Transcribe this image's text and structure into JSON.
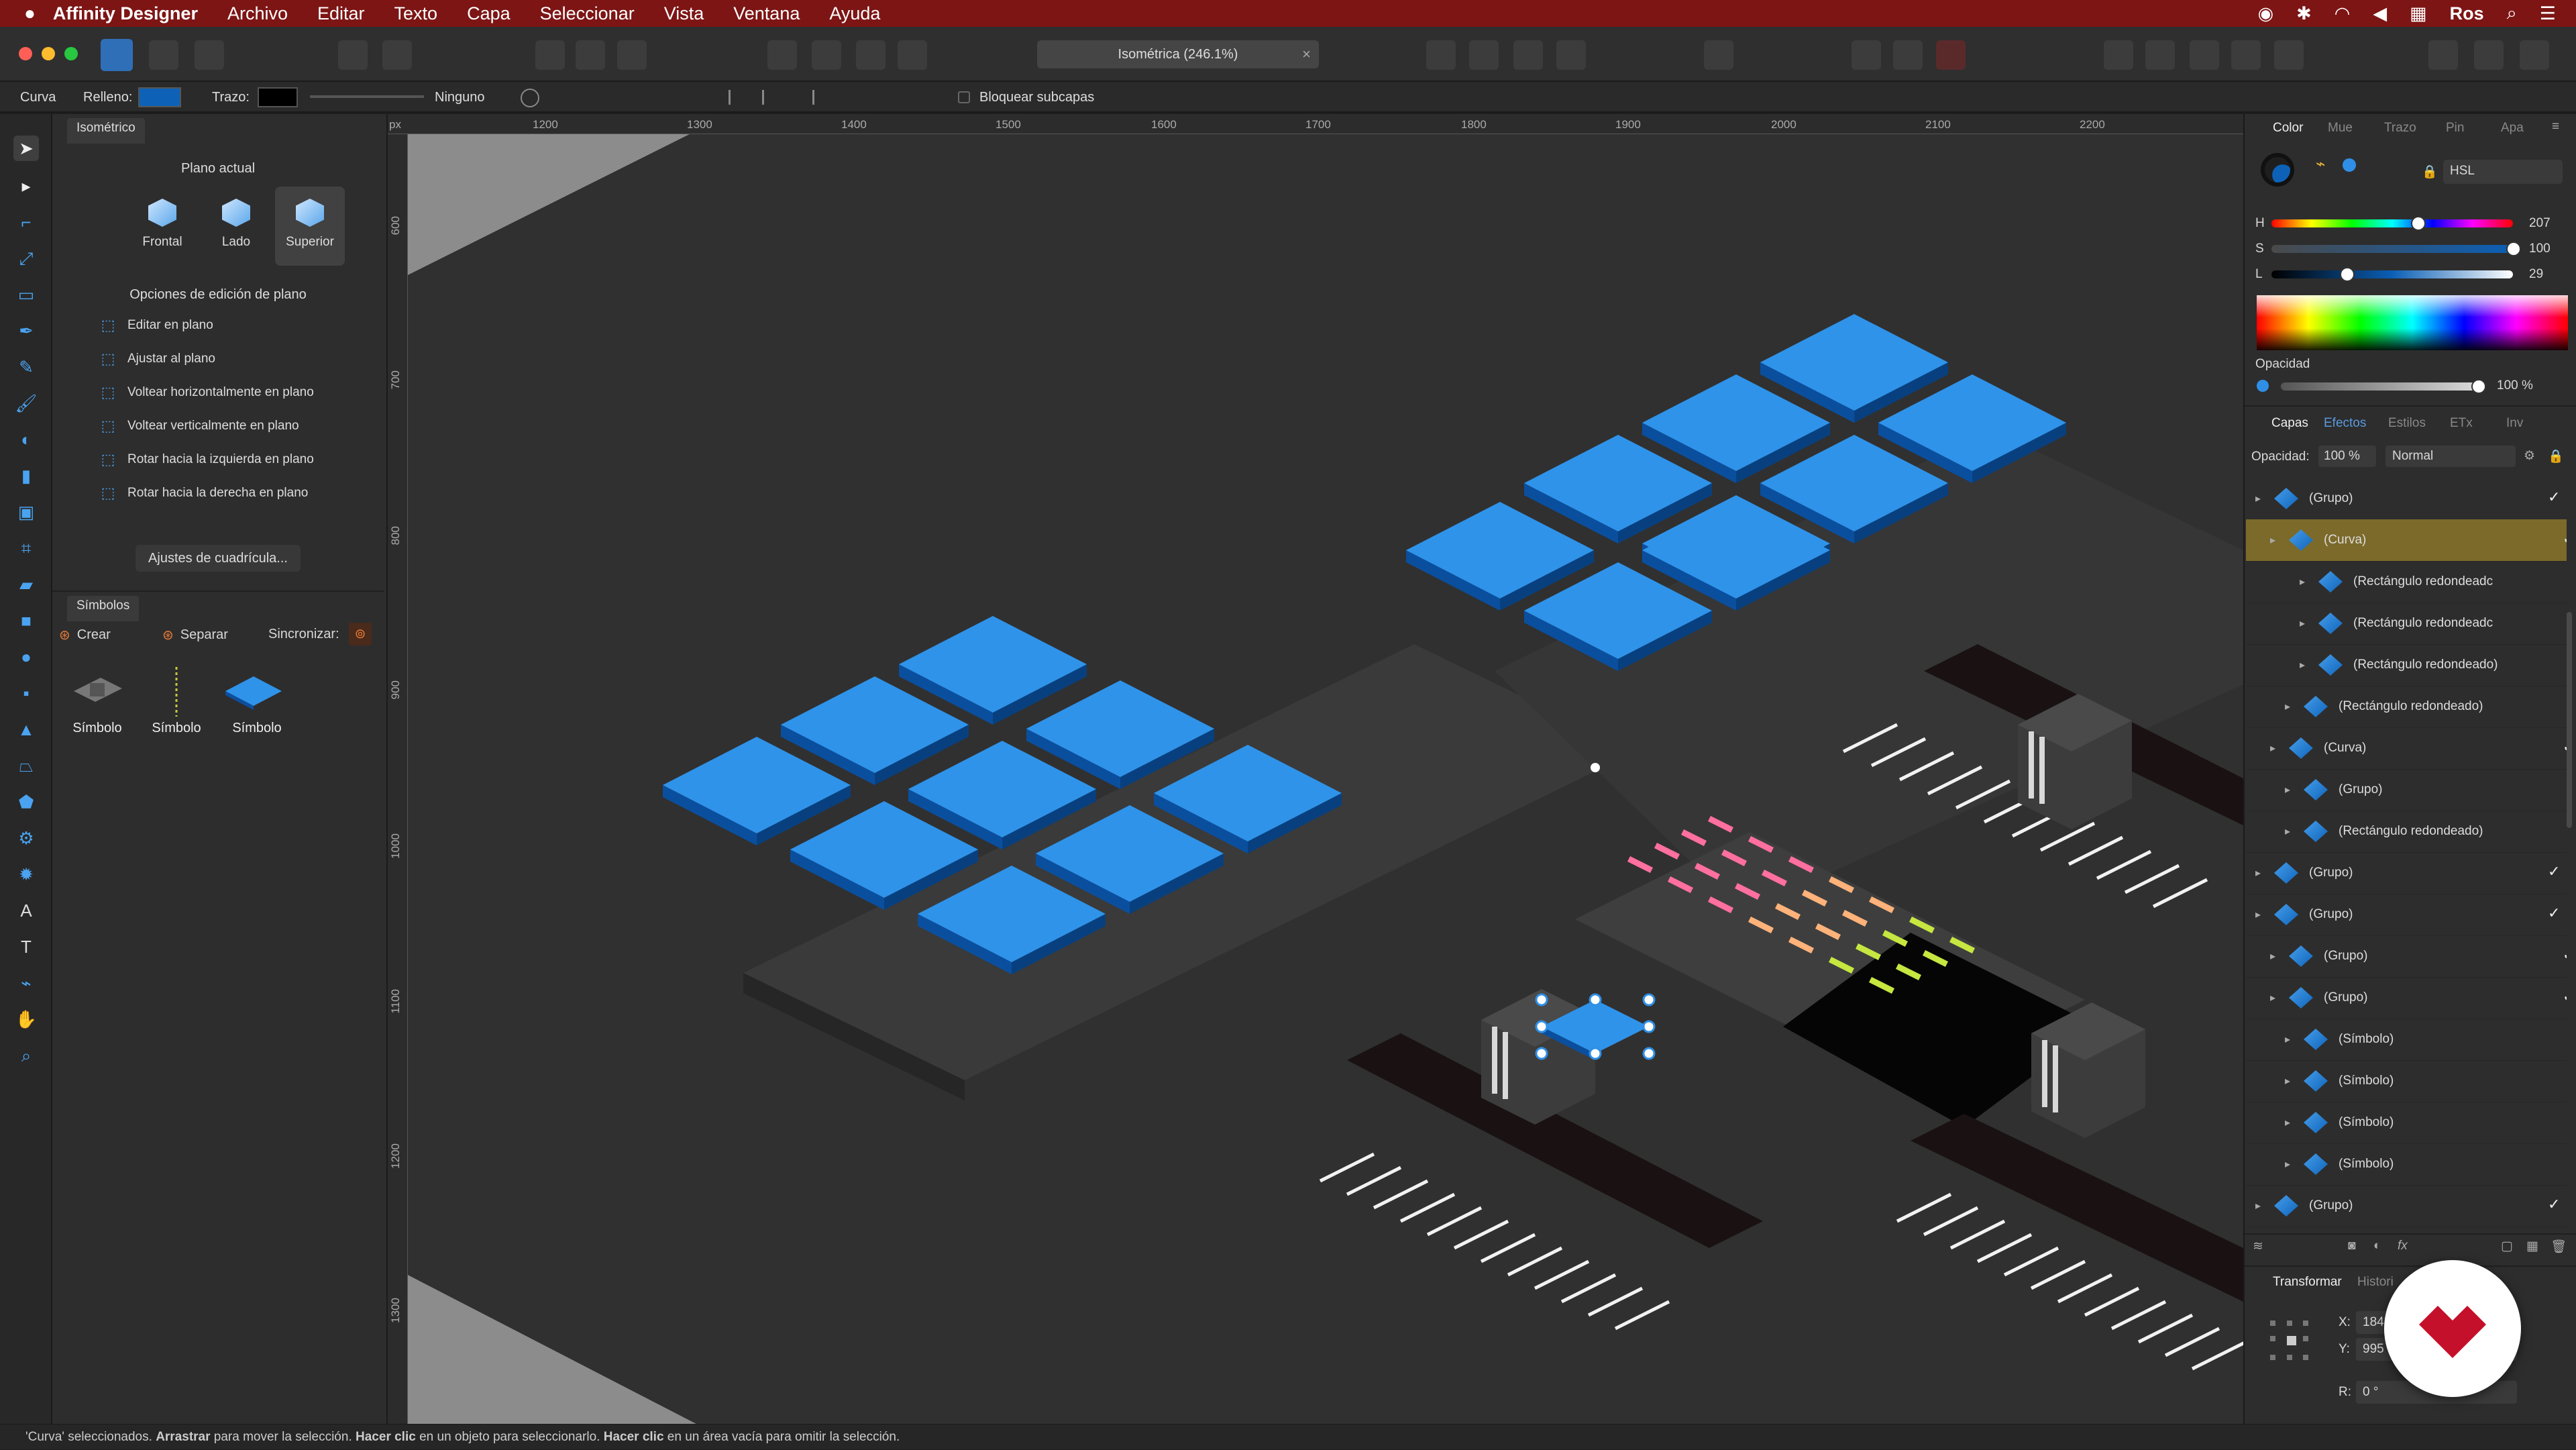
{
  "menubar": {
    "app_name": "Affinity Designer",
    "items": [
      "Archivo",
      "Editar",
      "Texto",
      "Capa",
      "Seleccionar",
      "Vista",
      "Ventana",
      "Ayuda"
    ],
    "user": "Ros"
  },
  "document_tab": {
    "title": "Isométrica (246.1%)"
  },
  "context": {
    "selection_type": "Curva",
    "fill_label": "Relleno:",
    "stroke_label": "Trazo:",
    "stroke_value": "Ninguno",
    "lock_sublayers": "Bloquear subcapas"
  },
  "left_panel": {
    "tab": "Isométrico",
    "current_plane_title": "Plano actual",
    "planes": [
      "Frontal",
      "Lado",
      "Superior"
    ],
    "edit_options_title": "Opciones de edición de plano",
    "options": [
      "Editar en plano",
      "Ajustar al plano",
      "Voltear horizontalmente en plano",
      "Voltear verticalmente en plano",
      "Rotar hacia la izquierda en plano",
      "Rotar hacia la derecha en plano"
    ],
    "grid_button": "Ajustes de cuadrícula...",
    "symbols_tab": "Símbolos",
    "symbols_create": "Crear",
    "symbols_detach": "Separar",
    "symbols_sync": "Sincronizar:",
    "symbols": [
      "Símbolo",
      "Símbolo",
      "Símbolo"
    ]
  },
  "ruler": {
    "unit": "px",
    "top_ticks": [
      "1200",
      "1300",
      "1400",
      "1500",
      "1600",
      "1700",
      "1800",
      "1900",
      "2000",
      "2100",
      "2200"
    ],
    "left_ticks": [
      "600",
      "700",
      "800",
      "900",
      "1000",
      "1100",
      "1200",
      "1300"
    ]
  },
  "right_panel": {
    "color_tabs": [
      "Color",
      "Mue",
      "Trazo",
      "Pin",
      "Apa"
    ],
    "color_mode": "HSL",
    "h_label": "H",
    "h_value": "207",
    "s_label": "S",
    "s_value": "100",
    "l_label": "L",
    "l_value": "29",
    "opacity_label": "Opacidad",
    "opacity_value": "100 %",
    "layer_tabs": [
      "Capas",
      "Efectos",
      "Estilos",
      "ETx",
      "Inv"
    ],
    "layer_opacity_label": "Opacidad:",
    "layer_opacity_value": "100 %",
    "blend_mode": "Normal",
    "layers": [
      {
        "name": "(Grupo)",
        "indent": 0,
        "selected": false,
        "fx": false
      },
      {
        "name": "(Curva)",
        "indent": 1,
        "selected": true,
        "fx": false
      },
      {
        "name": "(Rectángulo redondeadc",
        "indent": 3,
        "selected": false,
        "fx": true
      },
      {
        "name": "(Rectángulo redondeadc",
        "indent": 3,
        "selected": false,
        "fx": true
      },
      {
        "name": "(Rectángulo redondeado)",
        "indent": 3,
        "selected": false,
        "fx": false
      },
      {
        "name": "(Rectángulo redondeado)",
        "indent": 2,
        "selected": false,
        "fx": false
      },
      {
        "name": "(Curva)",
        "indent": 1,
        "selected": false,
        "fx": false
      },
      {
        "name": "(Grupo)",
        "indent": 2,
        "selected": false,
        "fx": false
      },
      {
        "name": "(Rectángulo redondeado)",
        "indent": 2,
        "selected": false,
        "fx": false
      },
      {
        "name": "(Grupo)",
        "indent": 0,
        "selected": false,
        "fx": false
      },
      {
        "name": "(Grupo)",
        "indent": 0,
        "selected": false,
        "fx": false
      },
      {
        "name": "(Grupo)",
        "indent": 1,
        "selected": false,
        "fx": false
      },
      {
        "name": "(Grupo)",
        "indent": 1,
        "selected": false,
        "fx": false
      },
      {
        "name": "(Símbolo)",
        "indent": 2,
        "selected": false,
        "fx": false
      },
      {
        "name": "(Símbolo)",
        "indent": 2,
        "selected": false,
        "fx": false
      },
      {
        "name": "(Símbolo)",
        "indent": 2,
        "selected": false,
        "fx": false
      },
      {
        "name": "(Símbolo)",
        "indent": 2,
        "selected": false,
        "fx": false
      },
      {
        "name": "(Grupo)",
        "indent": 0,
        "selected": false,
        "fx": false
      }
    ],
    "transform_tabs": [
      "Transformar",
      "Histori"
    ],
    "x_label": "X:",
    "x_value": "184",
    "y_label": "Y:",
    "y_value": "995",
    "r_label": "R:",
    "r_value": "0 °"
  },
  "status": {
    "parts": [
      "'Curva' seleccionados. ",
      "Arrastrar",
      " para mover la selección. ",
      "Hacer clic",
      " en un objeto para seleccionarlo. ",
      "Hacer clic",
      " en un área vacía para omitir la selección."
    ]
  },
  "colors": {
    "accent": "#2f8fe6",
    "menubar": "#7d1515",
    "selected_layer": "#7b6a2a"
  }
}
